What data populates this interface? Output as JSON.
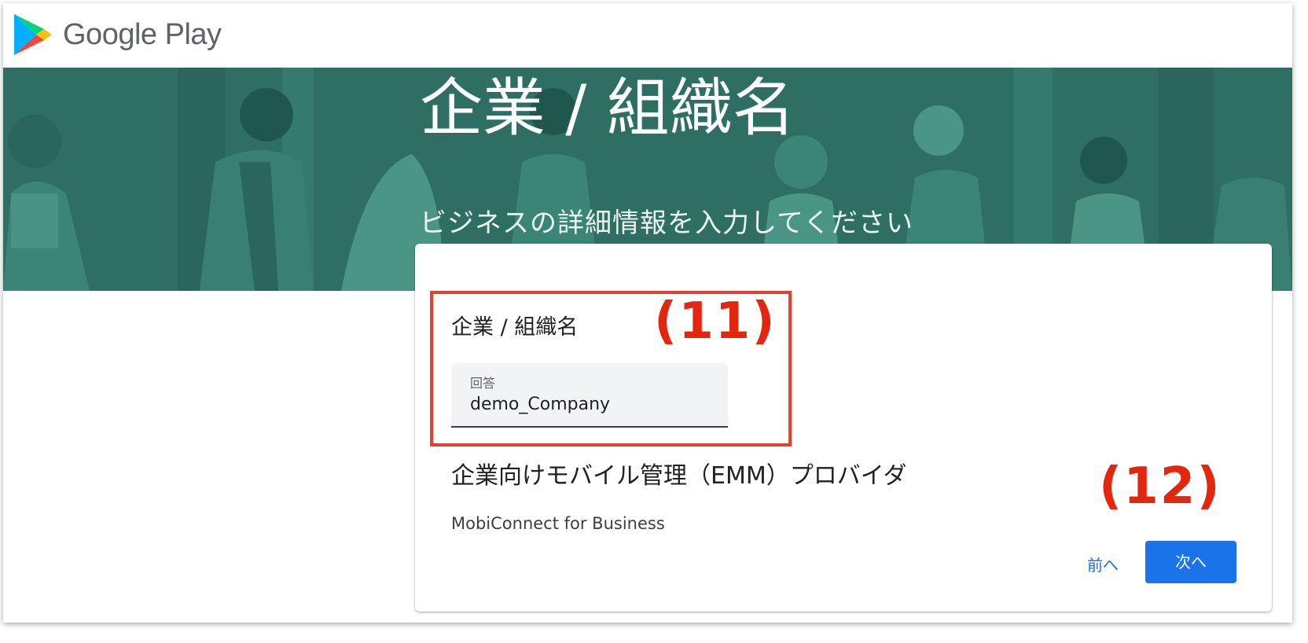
{
  "brand": {
    "name": "Google Play",
    "icon": "google-play-logo-icon"
  },
  "banner": {
    "title": "企業 / 組織名",
    "subtitle": "ビジネスの詳細情報を入力してください"
  },
  "form": {
    "question1": {
      "label": "企業 / 組織名",
      "answer_label": "回答",
      "answer_value": "demo_Company"
    },
    "question2": {
      "label": "企業向けモバイル管理（EMM）プロバイダ",
      "value": "MobiConnect for Business"
    },
    "buttons": {
      "prev": "前へ",
      "next": "次へ"
    }
  },
  "annotations": {
    "a11": "(11)",
    "a12": "(12)"
  },
  "colors": {
    "banner_bg": "#2f6f63",
    "accent_blue": "#1a73e8",
    "annotation_red": "#e5412f"
  }
}
